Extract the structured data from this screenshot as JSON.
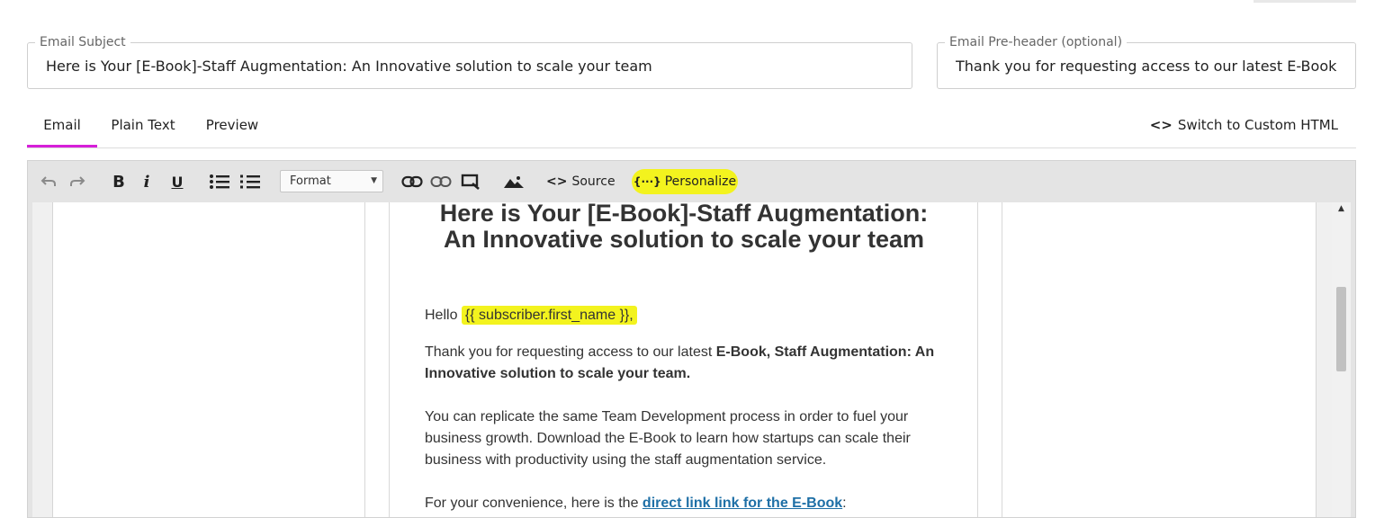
{
  "subject": {
    "label": "Email Subject",
    "value": "Here is Your [E-Book]-Staff Augmentation: An Innovative solution to scale your team"
  },
  "preheader": {
    "label": "Email Pre-header (optional)",
    "value": "Thank you for requesting access to our latest E-Book,"
  },
  "tabs": [
    {
      "label": "Email",
      "active": true
    },
    {
      "label": "Plain Text",
      "active": false
    },
    {
      "label": "Preview",
      "active": false
    }
  ],
  "switch_html": {
    "glyph": "<>",
    "label": "Switch to Custom HTML"
  },
  "toolbar": {
    "icons": [
      "undo-icon",
      "redo-icon",
      "bold-icon",
      "italic-icon",
      "underline-icon",
      "bulleted-list-icon",
      "numbered-list-icon",
      "link-icon",
      "unlink-icon",
      "anchor-icon",
      "image-icon"
    ],
    "format_label": "Format",
    "source_glyph": "<>",
    "source_label": "Source",
    "personalize_glyph": "{···}",
    "personalize_label": "Personalize"
  },
  "email": {
    "title_line1": "Here is Your [E-Book]-Staff Augmentation:",
    "title_line2": "An Innovative solution to scale your team",
    "greeting": "Hello",
    "merge_tag": "{{ subscriber.first_name }},",
    "para1_plain": "Thank you for requesting access to our latest",
    "para1_bold": "E-Book, Staff Augmentation: An Innovative solution to scale your team.",
    "para2": "You can replicate the same Team Development process in order to fuel your business growth. Download the E-Book to learn how startups can scale their business with productivity using the staff augmentation service.",
    "para3_plain": "For your convenience, here is the",
    "para3_link": "direct link link for the E-Book",
    "para3_end": ":"
  },
  "colors": {
    "accent_tab": "#d61fd9",
    "highlight": "#f3f31e",
    "link": "#1e6fa6"
  }
}
